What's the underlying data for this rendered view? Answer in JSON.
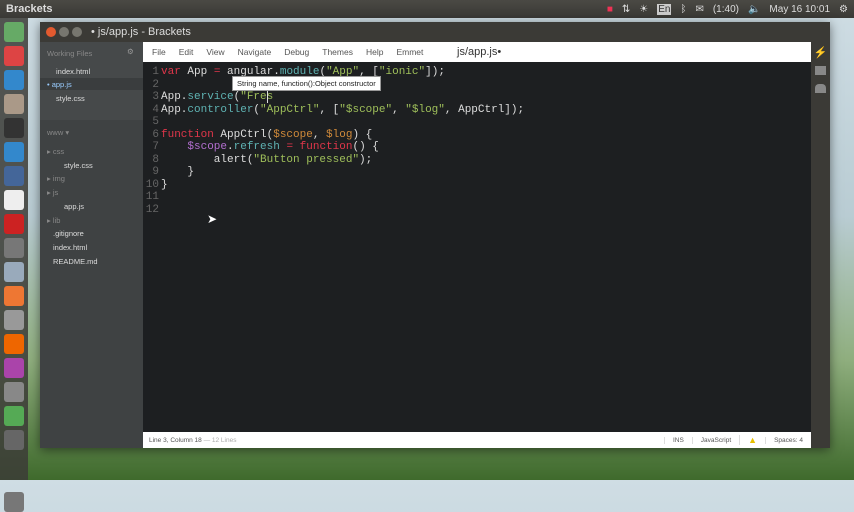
{
  "topbar": {
    "title": "Brackets",
    "battery": "(1:40)",
    "clock": "May 16 10:01",
    "lang": "En"
  },
  "window": {
    "title": "• js/app.js - Brackets"
  },
  "sidebar": {
    "working_files_label": "Working Files",
    "working_files": [
      "index.html",
      "app.js",
      "style.css"
    ],
    "project": "www ▾",
    "tree": [
      {
        "label": "css",
        "indent": 0,
        "folder": true
      },
      {
        "label": "style.css",
        "indent": 1
      },
      {
        "label": "img",
        "indent": 0,
        "folder": true
      },
      {
        "label": "js",
        "indent": 0,
        "folder": true
      },
      {
        "label": "app.js",
        "indent": 1
      },
      {
        "label": "lib",
        "indent": 0,
        "folder": true
      },
      {
        "label": ".gitignore",
        "indent": 0
      },
      {
        "label": "index.html",
        "indent": 0
      },
      {
        "label": "README.md",
        "indent": 0
      }
    ]
  },
  "menu": [
    "File",
    "Edit",
    "View",
    "Navigate",
    "Debug",
    "Themes",
    "Help",
    "Emmet"
  ],
  "doc_title": "js/app.js•",
  "code_lines": [
    "<span class=kw>var</span> App <span class=kw>=</span> angular.<span class=fn>module</span>(<span class=st>\"App\"</span>, [<span class=st>\"ionic\"</span>]);",
    "",
    "App.<span class=fn>service</span>(<span class=st>\"Fres</span>",
    "App.<span class=fn>controller</span>(<span class=st>\"AppCtrl\"</span>, [<span class=st>\"$scope\"</span>, <span class=st>\"$log\"</span>, AppCtrl]);",
    "",
    "<span class=kw>function</span> AppCtrl(<span class=pa>$scope</span>, <span class=pa>$log</span>) {",
    "    <span class=pu>$scope</span>.<span class=fn>refresh</span> <span class=kw>=</span> <span class=kw>function</span>() {",
    "        alert(<span class=st>\"Button pressed\"</span>);",
    "    }",
    "}",
    "",
    ""
  ],
  "tooltip": "String name, function():Object constructor",
  "status": {
    "position": "Line 3, Column 18",
    "lines": "— 12 Lines",
    "mode": "INS",
    "language": "JavaScript",
    "spaces": "Spaces: 4"
  }
}
